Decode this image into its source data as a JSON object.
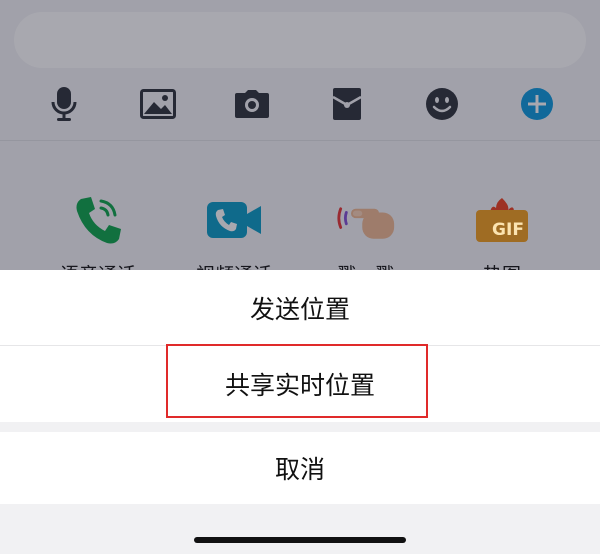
{
  "background": {
    "toolbar_icons": [
      "microphone-icon",
      "image-icon",
      "camera-icon",
      "red-envelope-icon",
      "emoji-icon",
      "plus-icon"
    ],
    "apps": [
      {
        "label": "语音通话",
        "icon": "voice-call-icon"
      },
      {
        "label": "视频通话",
        "icon": "video-call-icon"
      },
      {
        "label": "戳一戳",
        "icon": "poke-icon"
      },
      {
        "label": "热图",
        "icon": "gif-icon"
      }
    ],
    "gif_badge": "GIF",
    "accent_color": "#1aa0e0"
  },
  "sheet": {
    "send_location": "发送位置",
    "share_live_location": "共享实时位置",
    "cancel": "取消",
    "highlight_color": "#e02a2a"
  }
}
